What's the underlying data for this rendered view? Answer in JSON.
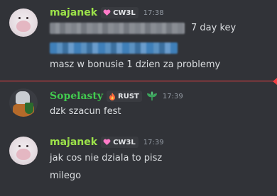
{
  "messages": [
    {
      "author": "majanek",
      "tag": "CW3L",
      "time": "17:38",
      "lines": [
        "7 day key",
        "masz w bonusie 1 dzien za problemy"
      ]
    },
    {
      "author": "Sopelasty",
      "tag": "RUST",
      "time": "17:39",
      "lines": [
        "dzk szacun fest"
      ]
    },
    {
      "author": "majanek",
      "tag": "CW3L",
      "time": "17:39",
      "lines": [
        "jak cos nie dziala to pisz",
        "milego"
      ]
    }
  ],
  "icons": {
    "heart-tag": "heart-icon",
    "fire-tag": "fire-icon",
    "role": "leaf-icon"
  },
  "colors": {
    "background": "#313338",
    "majanek_name": "#9de34a",
    "sopelasty_name": "#42c94f",
    "new_divider": "#f23f43"
  }
}
